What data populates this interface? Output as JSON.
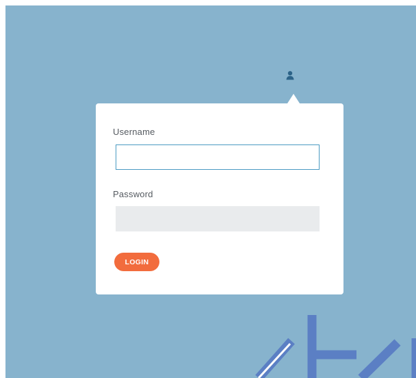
{
  "login": {
    "username_label": "Username",
    "password_label": "Password",
    "username_value": "",
    "password_value": "",
    "login_button": "LOGIN"
  },
  "icons": {
    "user": "user-icon"
  },
  "colors": {
    "background": "#87b3cd",
    "card": "#ffffff",
    "accent": "#f26c3d",
    "input_focus_border": "#4a9ac2",
    "input_fill": "#e9ebed",
    "decoration": "#5b7fc4"
  }
}
